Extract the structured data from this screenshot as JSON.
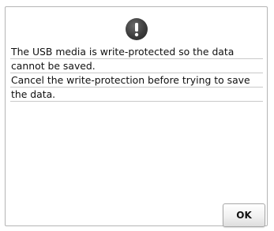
{
  "dialog": {
    "icon": "exclamation-icon",
    "message_lines": [
      "The USB media is write-protected so the data",
      "cannot be saved.",
      "Cancel the write-protection before trying to save",
      "the data."
    ],
    "ok_label": "OK"
  },
  "colors": {
    "icon_fill": "#3c3c3c",
    "text": "#111111",
    "divider": "#c9c9c9"
  }
}
